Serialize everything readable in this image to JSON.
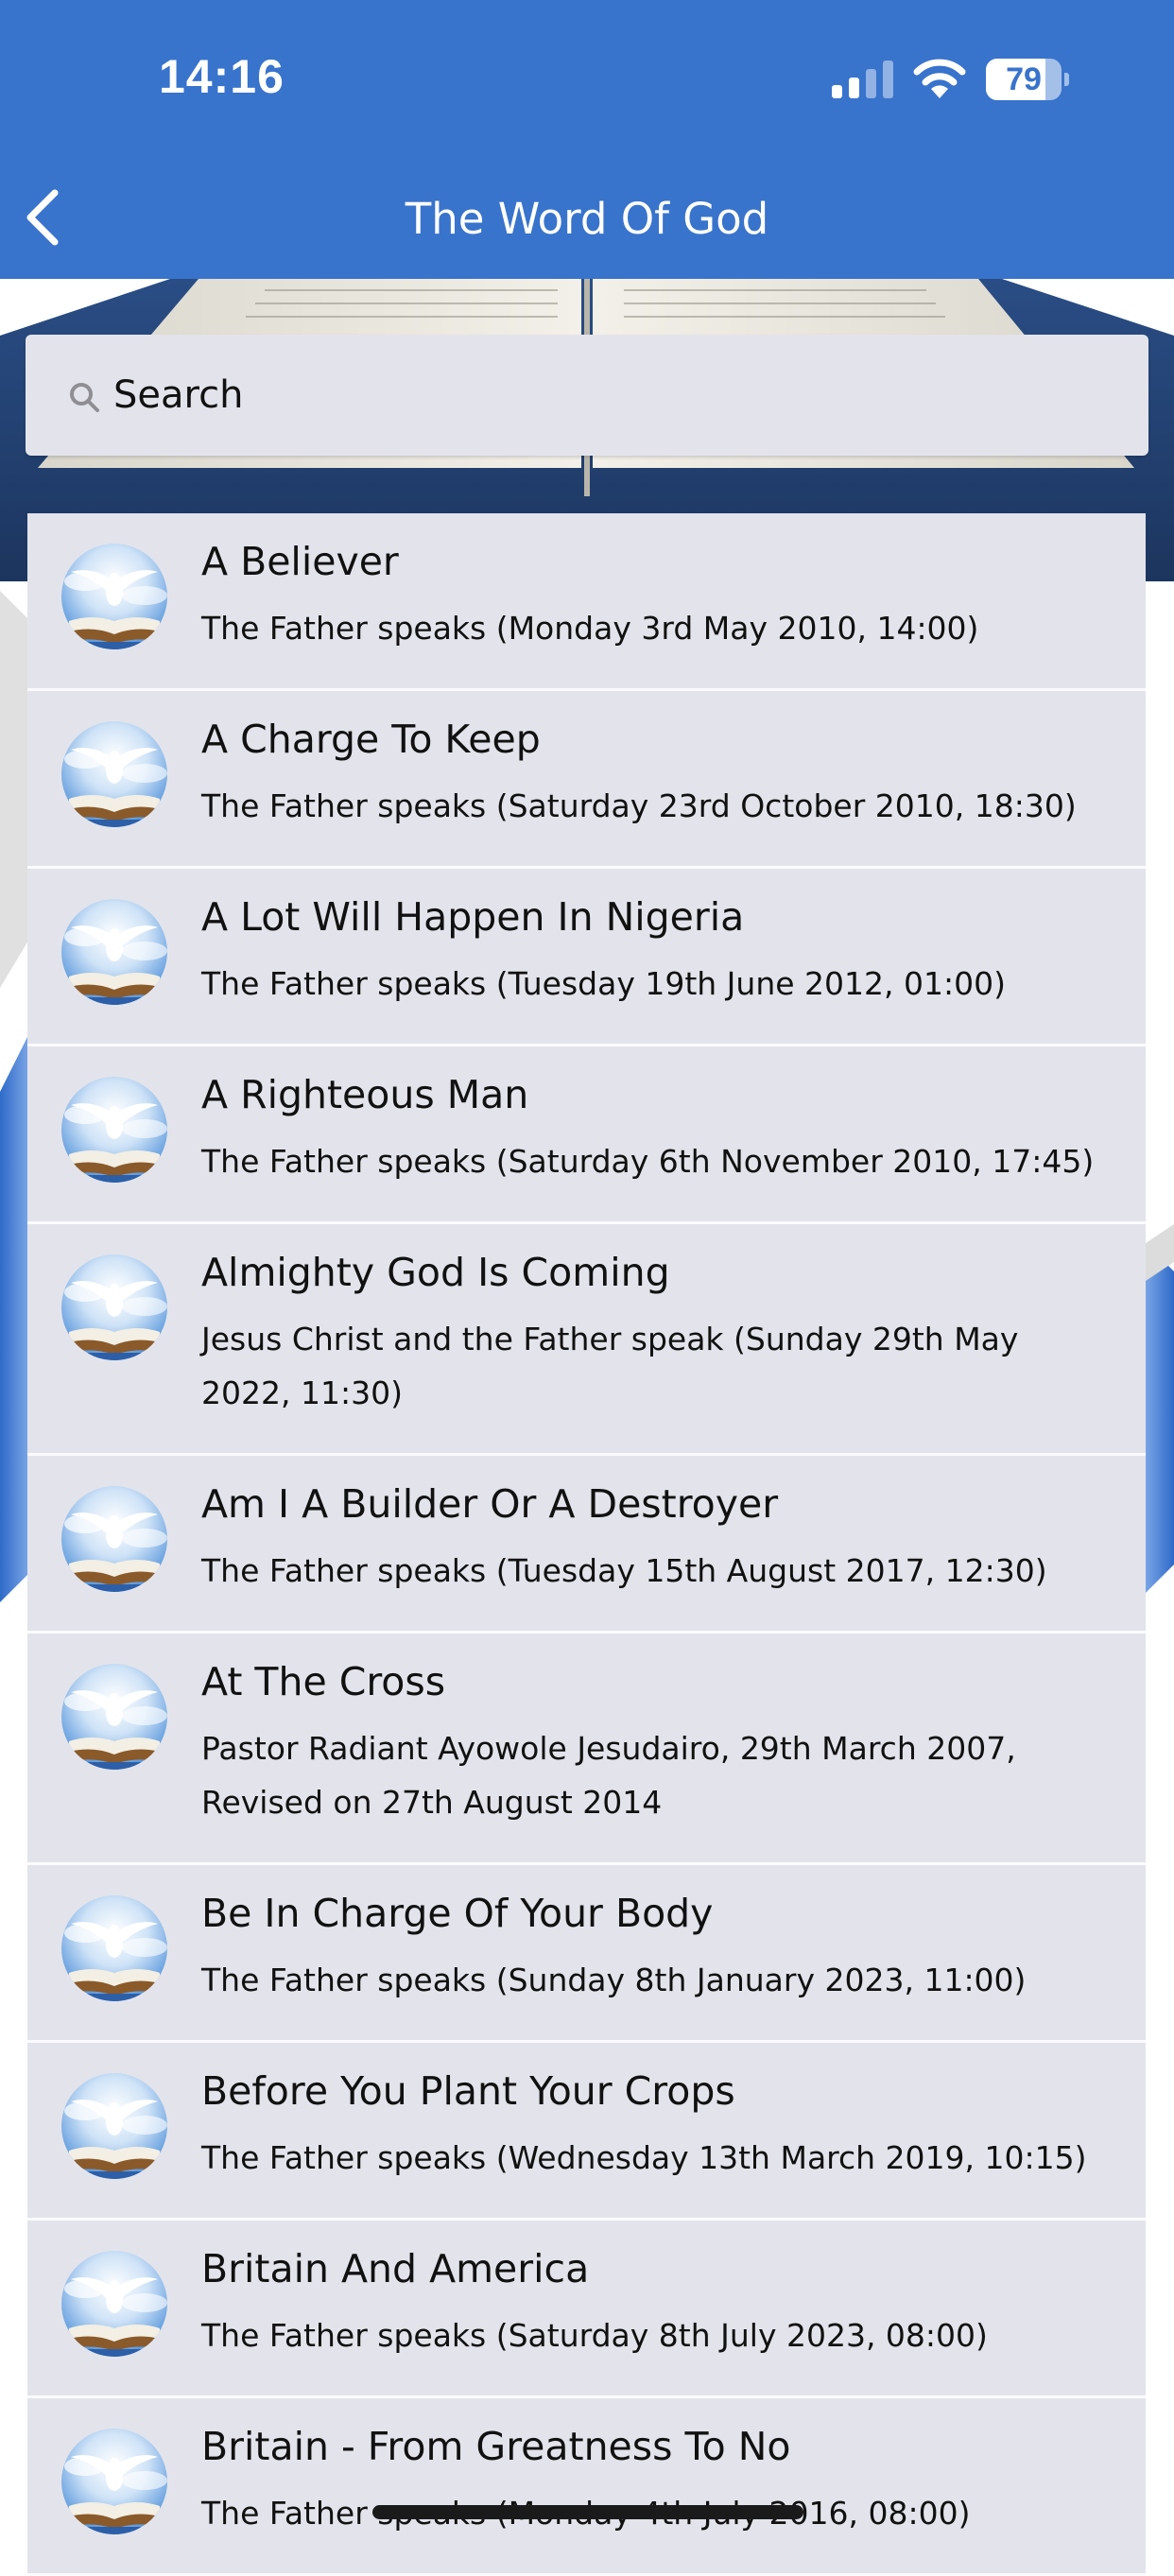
{
  "status_bar": {
    "time": "14:16",
    "battery": "79",
    "battery_level": 0.79
  },
  "nav": {
    "title": "The Word Of God",
    "back_icon": "chevron-left-icon"
  },
  "search": {
    "placeholder": "Search",
    "icon": "search-icon"
  },
  "colors": {
    "header": "#3873cc",
    "list_background": "#e3e4eb",
    "separator": "#fbfbfd"
  },
  "items": [
    {
      "title": "A Believer",
      "subtitle": "The Father speaks (Monday 3rd May 2010, 14:00)"
    },
    {
      "title": "A Charge To Keep",
      "subtitle": "The Father speaks (Saturday 23rd October 2010, 18:30)"
    },
    {
      "title": "A Lot Will Happen In Nigeria",
      "subtitle": "The Father speaks (Tuesday 19th June 2012, 01:00)"
    },
    {
      "title": "A Righteous Man",
      "subtitle": "The Father speaks (Saturday 6th November 2010, 17:45)"
    },
    {
      "title": "Almighty God Is Coming",
      "subtitle": "Jesus Christ and the Father speak (Sunday 29th May 2022, 11:30)"
    },
    {
      "title": "Am I A Builder Or A Destroyer",
      "subtitle": "The Father speaks (Tuesday 15th August 2017, 12:30)"
    },
    {
      "title": "At The Cross",
      "subtitle": "Pastor Radiant Ayowole Jesudairo, 29th March 2007, Revised on 27th August 2014"
    },
    {
      "title": "Be In Charge Of Your Body",
      "subtitle": "The Father speaks (Sunday 8th January 2023, 11:00)"
    },
    {
      "title": "Before You Plant Your Crops",
      "subtitle": "The Father speaks (Wednesday 13th March 2019, 10:15)"
    },
    {
      "title": "Britain And America",
      "subtitle": "The Father speaks (Saturday 8th July 2023, 08:00)"
    },
    {
      "title": "Britain - From Greatness To No",
      "subtitle": "The Father speaks (Monday 4th July 2016, 08:00)"
    }
  ]
}
